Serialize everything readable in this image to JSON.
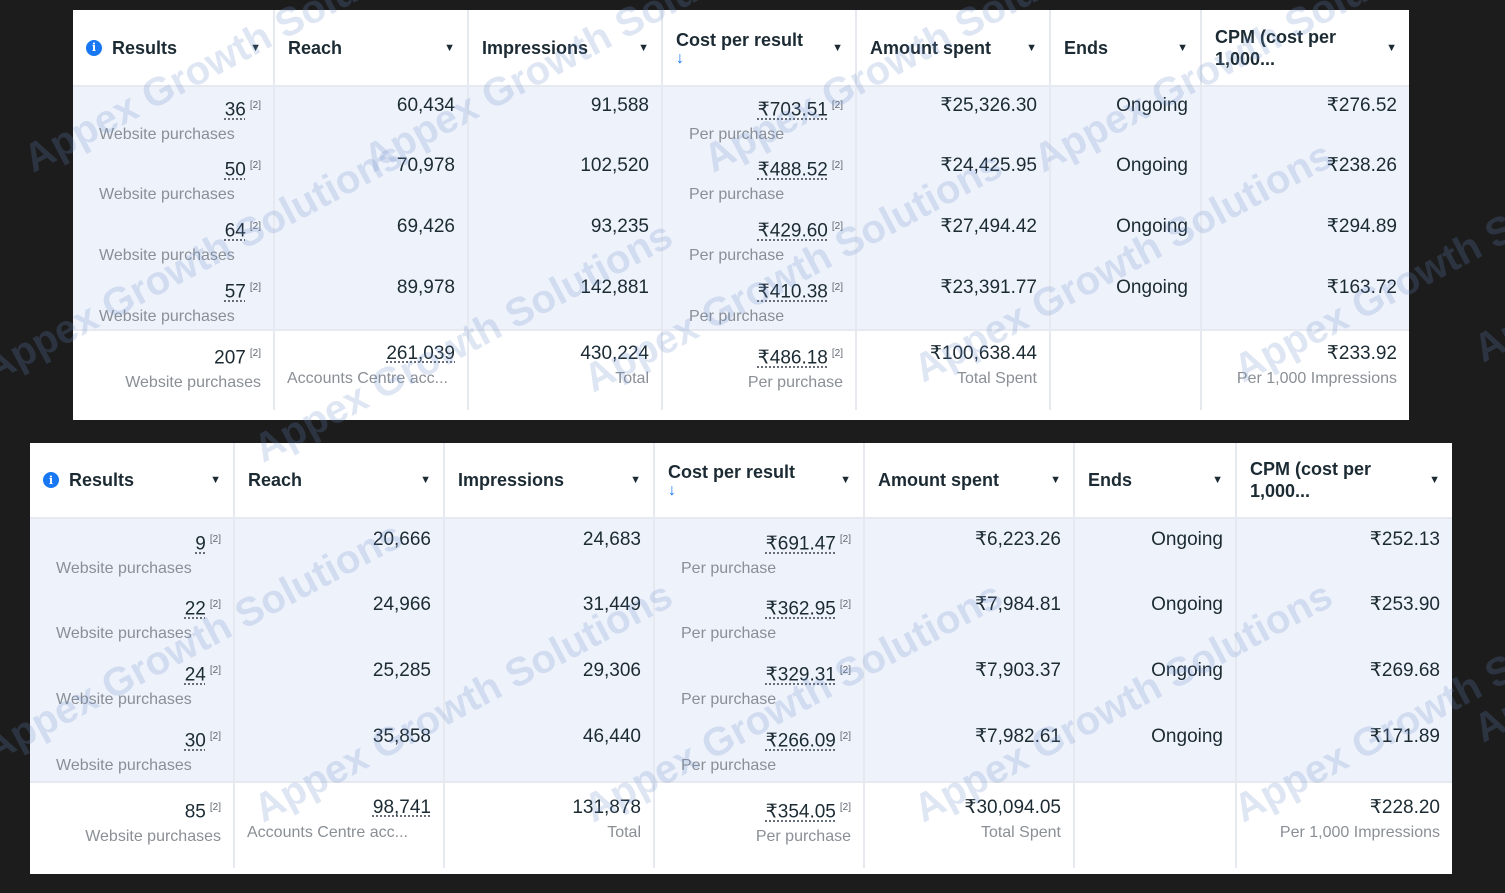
{
  "columns": {
    "results": "Results",
    "reach": "Reach",
    "impressions": "Impressions",
    "cost_per_result": "Cost per result",
    "amount_spent": "Amount spent",
    "ends": "Ends",
    "cpm_line1": "CPM (cost per",
    "cpm_line2": "1,000..."
  },
  "icons": {
    "info": "info-icon",
    "caret": "caret-down-icon",
    "sort": "arrow-down-icon",
    "badge": "[2]"
  },
  "watermark": "Appex Growth Solutions",
  "tables": [
    {
      "rows": [
        {
          "results": "36",
          "results_sub": "Website purchases",
          "reach": "60,434",
          "impressions": "91,588",
          "cost": "₹703.51",
          "cost_sub": "Per purchase",
          "spent": "₹25,326.30",
          "ends": "Ongoing",
          "cpm": "₹276.52"
        },
        {
          "results": "50",
          "results_sub": "Website purchases",
          "reach": "70,978",
          "impressions": "102,520",
          "cost": "₹488.52",
          "cost_sub": "Per purchase",
          "spent": "₹24,425.95",
          "ends": "Ongoing",
          "cpm": "₹238.26"
        },
        {
          "results": "64",
          "results_sub": "Website purchases",
          "reach": "69,426",
          "impressions": "93,235",
          "cost": "₹429.60",
          "cost_sub": "Per purchase",
          "spent": "₹27,494.42",
          "ends": "Ongoing",
          "cpm": "₹294.89"
        },
        {
          "results": "57",
          "results_sub": "Website purchases",
          "reach": "89,978",
          "impressions": "142,881",
          "cost": "₹410.38",
          "cost_sub": "Per purchase",
          "spent": "₹23,391.77",
          "ends": "Ongoing",
          "cpm": "₹163.72"
        }
      ],
      "total": {
        "results": "207",
        "results_sub": "Website purchases",
        "reach": "261,039",
        "reach_sub": "Accounts Centre acc...",
        "impressions": "430,224",
        "impressions_sub": "Total",
        "cost": "₹486.18",
        "cost_sub": "Per purchase",
        "spent": "₹100,638.44",
        "spent_sub": "Total Spent",
        "cpm": "₹233.92",
        "cpm_sub": "Per 1,000 Impressions"
      }
    },
    {
      "rows": [
        {
          "results": "9",
          "results_sub": "Website purchases",
          "reach": "20,666",
          "impressions": "24,683",
          "cost": "₹691.47",
          "cost_sub": "Per purchase",
          "spent": "₹6,223.26",
          "ends": "Ongoing",
          "cpm": "₹252.13"
        },
        {
          "results": "22",
          "results_sub": "Website purchases",
          "reach": "24,966",
          "impressions": "31,449",
          "cost": "₹362.95",
          "cost_sub": "Per purchase",
          "spent": "₹7,984.81",
          "ends": "Ongoing",
          "cpm": "₹253.90"
        },
        {
          "results": "24",
          "results_sub": "Website purchases",
          "reach": "25,285",
          "impressions": "29,306",
          "cost": "₹329.31",
          "cost_sub": "Per purchase",
          "spent": "₹7,903.37",
          "ends": "Ongoing",
          "cpm": "₹269.68"
        },
        {
          "results": "30",
          "results_sub": "Website purchases",
          "reach": "35,858",
          "impressions": "46,440",
          "cost": "₹266.09",
          "cost_sub": "Per purchase",
          "spent": "₹7,982.61",
          "ends": "Ongoing",
          "cpm": "₹171.89"
        }
      ],
      "total": {
        "results": "85",
        "results_sub": "Website purchases",
        "reach": "98,741",
        "reach_sub": "Accounts Centre acc...",
        "impressions": "131,878",
        "impressions_sub": "Total",
        "cost": "₹354.05",
        "cost_sub": "Per purchase",
        "spent": "₹30,094.05",
        "spent_sub": "Total Spent",
        "cpm": "₹228.20",
        "cpm_sub": "Per 1,000 Impressions"
      }
    }
  ]
}
